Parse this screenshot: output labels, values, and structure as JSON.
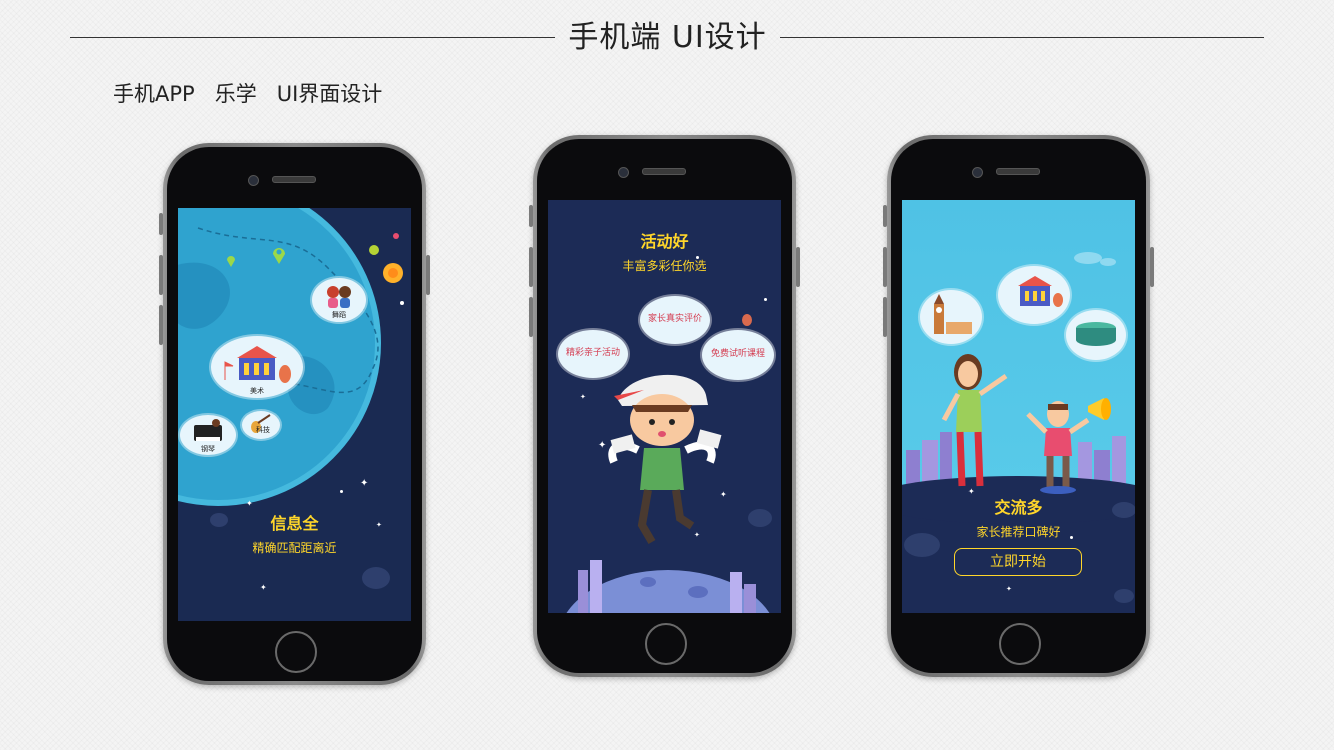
{
  "header": {
    "title": "手机端 UI设计",
    "subtitle": "手机APP   乐学   UI界面设计"
  },
  "screens": [
    {
      "bubbles": [
        "舞蹈",
        "美术",
        "钢琴",
        "科技"
      ],
      "title": "信息全",
      "subtitle": "精确匹配距离近"
    },
    {
      "title": "活动好",
      "subtitle": "丰富多彩任你选",
      "bubbles": [
        "家长真实评价",
        "精彩亲子活动",
        "免费试听课程"
      ]
    },
    {
      "title": "交流多",
      "subtitle": "家长推荐口碑好",
      "button_label": "立即开始"
    }
  ],
  "colors": {
    "accent_yellow": "#ffd62a",
    "screen_navy": "#1c2b56",
    "sky_blue": "#4fc2e5",
    "bubble_text_red": "#d43c50"
  },
  "icons": [
    "camera-icon",
    "speaker-icon",
    "home-button-icon",
    "map-pin-icon",
    "planet-icon",
    "palace-icon",
    "piano-icon",
    "guitar-icon",
    "big-ben-icon",
    "stadium-icon",
    "megaphone-icon"
  ]
}
